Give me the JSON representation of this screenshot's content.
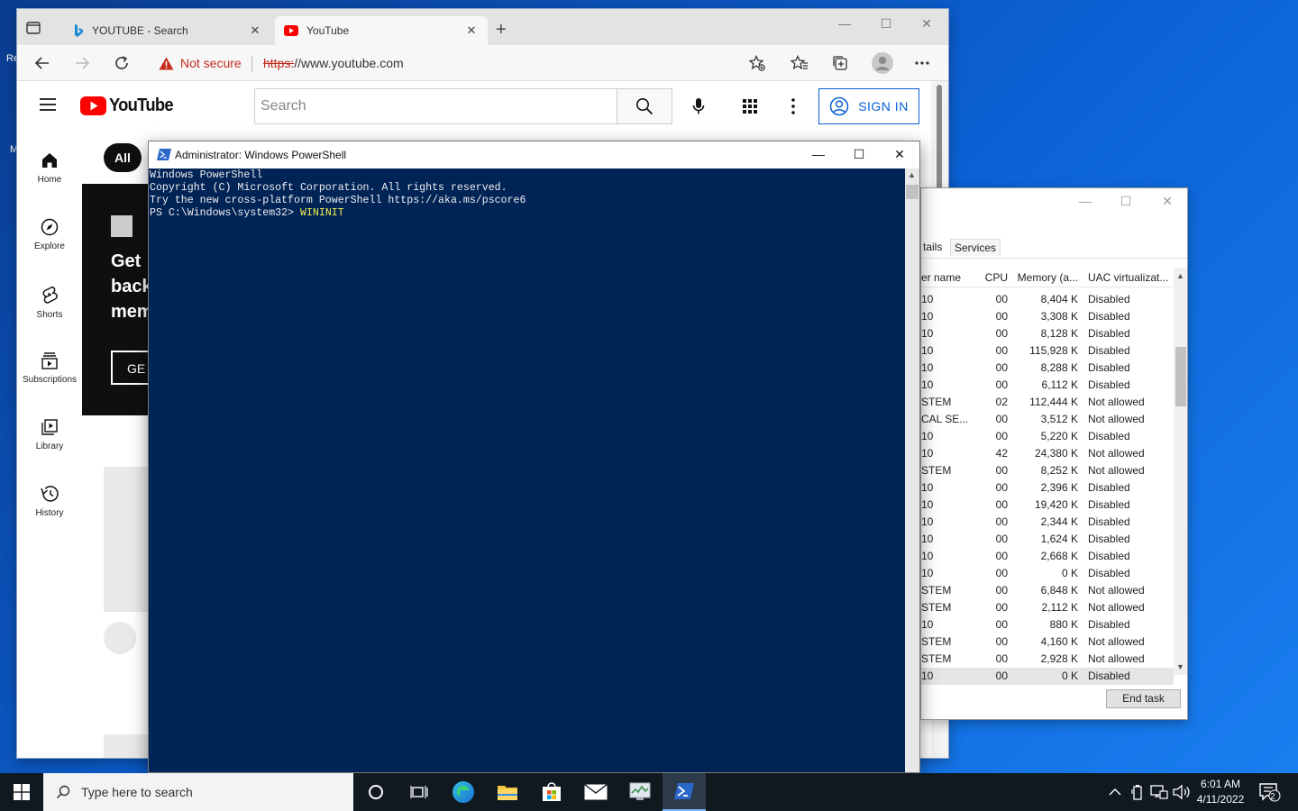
{
  "desktop": {
    "fragments": [
      "Re",
      "M"
    ]
  },
  "browser": {
    "tabs": [
      {
        "label": "YOUTUBE - Search",
        "active": false
      },
      {
        "label": "YouTube",
        "active": true
      }
    ],
    "security_label": "Not secure",
    "url_scheme": "https:",
    "url_rest": "//www.youtube.com",
    "accent": "#c42b1c"
  },
  "youtube": {
    "logo_text": "YouTube",
    "search_placeholder": "Search",
    "sign_in_label": "SIGN IN",
    "sidebar": [
      {
        "label": "Home",
        "icon": "home-icon"
      },
      {
        "label": "Explore",
        "icon": "compass-icon"
      },
      {
        "label": "Shorts",
        "icon": "shorts-icon"
      },
      {
        "label": "Subscriptions",
        "icon": "subscriptions-icon"
      },
      {
        "label": "Library",
        "icon": "library-icon"
      },
      {
        "label": "History",
        "icon": "history-icon"
      }
    ],
    "chip_all": "All",
    "banner": {
      "line1": "Get",
      "line2": "back",
      "line3": "mem",
      "button": "GE"
    },
    "brand_color": "#ff0000",
    "signin_color": "#065fd4"
  },
  "powershell": {
    "title": "Administrator: Windows PowerShell",
    "lines": [
      "Windows PowerShell",
      "Copyright (C) Microsoft Corporation. All rights reserved.",
      "",
      "Try the new cross-platform PowerShell https://aka.ms/pscore6",
      ""
    ],
    "prompt": "PS C:\\Windows\\system32> ",
    "command": "WININIT",
    "bg_color": "#012456"
  },
  "task_manager": {
    "tabs": [
      "tails",
      "Services"
    ],
    "columns": {
      "name": "er name",
      "cpu": "CPU",
      "memory": "Memory (a...",
      "uac": "UAC virtualizat..."
    },
    "rows": [
      {
        "name": "10",
        "cpu": "00",
        "memory": "8,404 K",
        "uac": "Disabled"
      },
      {
        "name": "10",
        "cpu": "00",
        "memory": "3,308 K",
        "uac": "Disabled"
      },
      {
        "name": "10",
        "cpu": "00",
        "memory": "8,128 K",
        "uac": "Disabled"
      },
      {
        "name": "10",
        "cpu": "00",
        "memory": "115,928 K",
        "uac": "Disabled"
      },
      {
        "name": "10",
        "cpu": "00",
        "memory": "8,288 K",
        "uac": "Disabled"
      },
      {
        "name": "10",
        "cpu": "00",
        "memory": "6,112 K",
        "uac": "Disabled"
      },
      {
        "name": "STEM",
        "cpu": "02",
        "memory": "112,444 K",
        "uac": "Not allowed"
      },
      {
        "name": "CAL SE...",
        "cpu": "00",
        "memory": "3,512 K",
        "uac": "Not allowed"
      },
      {
        "name": "10",
        "cpu": "00",
        "memory": "5,220 K",
        "uac": "Disabled"
      },
      {
        "name": "10",
        "cpu": "42",
        "memory": "24,380 K",
        "uac": "Not allowed"
      },
      {
        "name": "STEM",
        "cpu": "00",
        "memory": "8,252 K",
        "uac": "Not allowed"
      },
      {
        "name": "10",
        "cpu": "00",
        "memory": "2,396 K",
        "uac": "Disabled"
      },
      {
        "name": "10",
        "cpu": "00",
        "memory": "19,420 K",
        "uac": "Disabled"
      },
      {
        "name": "10",
        "cpu": "00",
        "memory": "2,344 K",
        "uac": "Disabled"
      },
      {
        "name": "10",
        "cpu": "00",
        "memory": "1,624 K",
        "uac": "Disabled"
      },
      {
        "name": "10",
        "cpu": "00",
        "memory": "2,668 K",
        "uac": "Disabled"
      },
      {
        "name": "10",
        "cpu": "00",
        "memory": "0 K",
        "uac": "Disabled"
      },
      {
        "name": "STEM",
        "cpu": "00",
        "memory": "6,848 K",
        "uac": "Not allowed"
      },
      {
        "name": "STEM",
        "cpu": "00",
        "memory": "2,112 K",
        "uac": "Not allowed"
      },
      {
        "name": "10",
        "cpu": "00",
        "memory": "880 K",
        "uac": "Disabled"
      },
      {
        "name": "STEM",
        "cpu": "00",
        "memory": "4,160 K",
        "uac": "Not allowed"
      },
      {
        "name": "STEM",
        "cpu": "00",
        "memory": "2,928 K",
        "uac": "Not allowed"
      },
      {
        "name": "10",
        "cpu": "00",
        "memory": "0 K",
        "uac": "Disabled"
      }
    ],
    "end_task_label": "End task"
  },
  "taskbar": {
    "search_placeholder": "Type here to search",
    "time": "6:01 AM",
    "date": "4/11/2022",
    "notification_count": "2"
  }
}
